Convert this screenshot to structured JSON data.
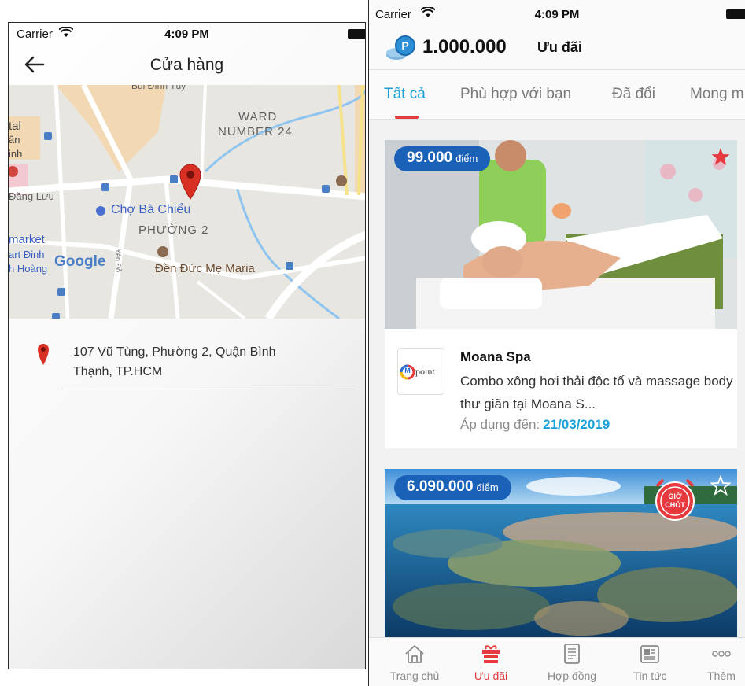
{
  "left_screen": {
    "status": {
      "carrier": "Carrier",
      "time": "4:09 PM"
    },
    "nav": {
      "title": "Cửa hàng",
      "back_icon": "arrow-left-icon"
    },
    "map": {
      "labels": {
        "bui_dinh_tuy": "Bùi Đình Túy",
        "ward1": "WARD",
        "ward2": "NUMBER 24",
        "tal": "tal",
        "an": "ân",
        "inh": "inh",
        "dang_luu": "Đăng Lưu",
        "cho_ba_chieu": "Chợ Bà Chiểu",
        "phuong2": "PHƯỜNG 2",
        "market": "market",
        "art_dinh": "art Đinh",
        "hoang": "h Hoàng",
        "google": "Google",
        "yen_do": "Yên Đỗ",
        "den_duc_me": "Đền Đức Mẹ Maria"
      },
      "accent_color": "#d93025"
    },
    "address": "107 Vũ Tùng, Phường 2, Quận Bình Thạnh, TP.HCM"
  },
  "right_screen": {
    "status": {
      "carrier": "Carrier",
      "time": "4:09 PM"
    },
    "points": {
      "value": "1.000.000",
      "title": "Ưu đãi"
    },
    "tabs": [
      "Tất cả",
      "Phù hợp với bạn",
      "Đã đổi",
      "Mong m"
    ],
    "active_tab": 0,
    "deals": [
      {
        "points": "99.000",
        "points_unit": "điểm",
        "merchant": "Moana Spa",
        "logo_text": "point",
        "logo_letter": "M",
        "description": "Combo xông hơi thải độc tố và massage body thư giãn tại Moana S...",
        "date_label": "Áp dụng đến:",
        "date_value": "21/03/2019",
        "favorite": true
      },
      {
        "points": "6.090.000",
        "points_unit": "điểm",
        "badge_line1": "GIỜ",
        "badge_line2": "CHÓT",
        "favorite": false
      }
    ],
    "bottom_nav": [
      {
        "label": "Trang chủ",
        "icon": "home-icon"
      },
      {
        "label": "Ưu đãi",
        "icon": "gift-icon"
      },
      {
        "label": "Hợp đồng",
        "icon": "contract-icon"
      },
      {
        "label": "Tin tức",
        "icon": "news-icon"
      },
      {
        "label": "Thêm",
        "icon": "more-icon"
      }
    ],
    "active_nav": 1,
    "colors": {
      "accent_blue": "#1aa0d8",
      "accent_red": "#e63a3f",
      "badge_blue": "#1a61b8"
    }
  }
}
